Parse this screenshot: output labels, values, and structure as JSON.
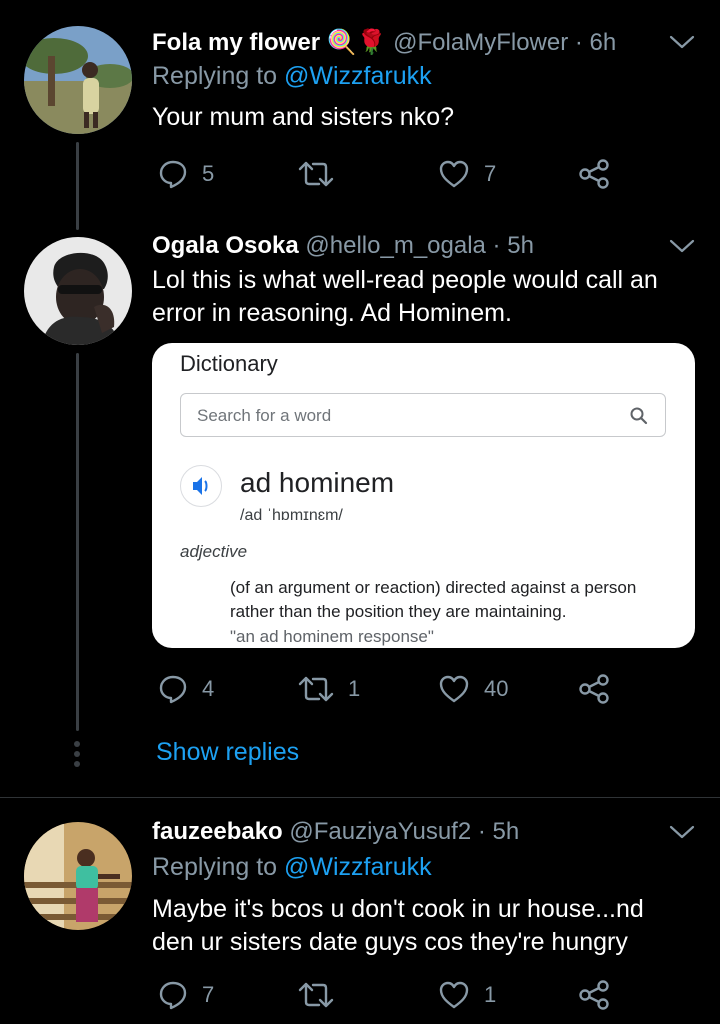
{
  "tweets": [
    {
      "display_name": "Fola my flower",
      "emojis": "🍭🌹",
      "meta": "@FolaMyFlower · 6h",
      "replying_prefix": "Replying to ",
      "replying_mention": "@Wizzfarukk",
      "body": "Your mum and sisters nko?",
      "replies": "5",
      "retweets": "",
      "likes": "7"
    },
    {
      "display_name": "Ogala Osoka",
      "meta": "@hello_m_ogala · 5h",
      "body": "Lol this is what well-read people would call an error in reasoning. Ad Hominem.",
      "replies": "4",
      "retweets": "1",
      "likes": "40",
      "card": {
        "title": "Dictionary",
        "search_placeholder": "Search for a word",
        "word": "ad hominem",
        "phonetic": "/ad ˈhɒmɪnɛm/",
        "part_of_speech": "adjective",
        "definition": "(of an argument or reaction) directed against a person rather than the position they are maintaining.",
        "example": "\"an ad hominem response\""
      }
    },
    {
      "display_name": "fauzeebako",
      "meta": "@FauziyaYusuf2 · 5h",
      "replying_prefix": "Replying to ",
      "replying_mention": "@Wizzfarukk",
      "body": "Maybe it's bcos u don't cook in ur house...nd den ur sisters date guys cos they're hungry",
      "replies": "7",
      "retweets": "",
      "likes": "1"
    }
  ],
  "show_replies": "Show replies",
  "colors": {
    "background": "#000000",
    "secondary_text": "#8899a6",
    "link": "#1da1f2",
    "thread_line": "#3a3f44"
  }
}
